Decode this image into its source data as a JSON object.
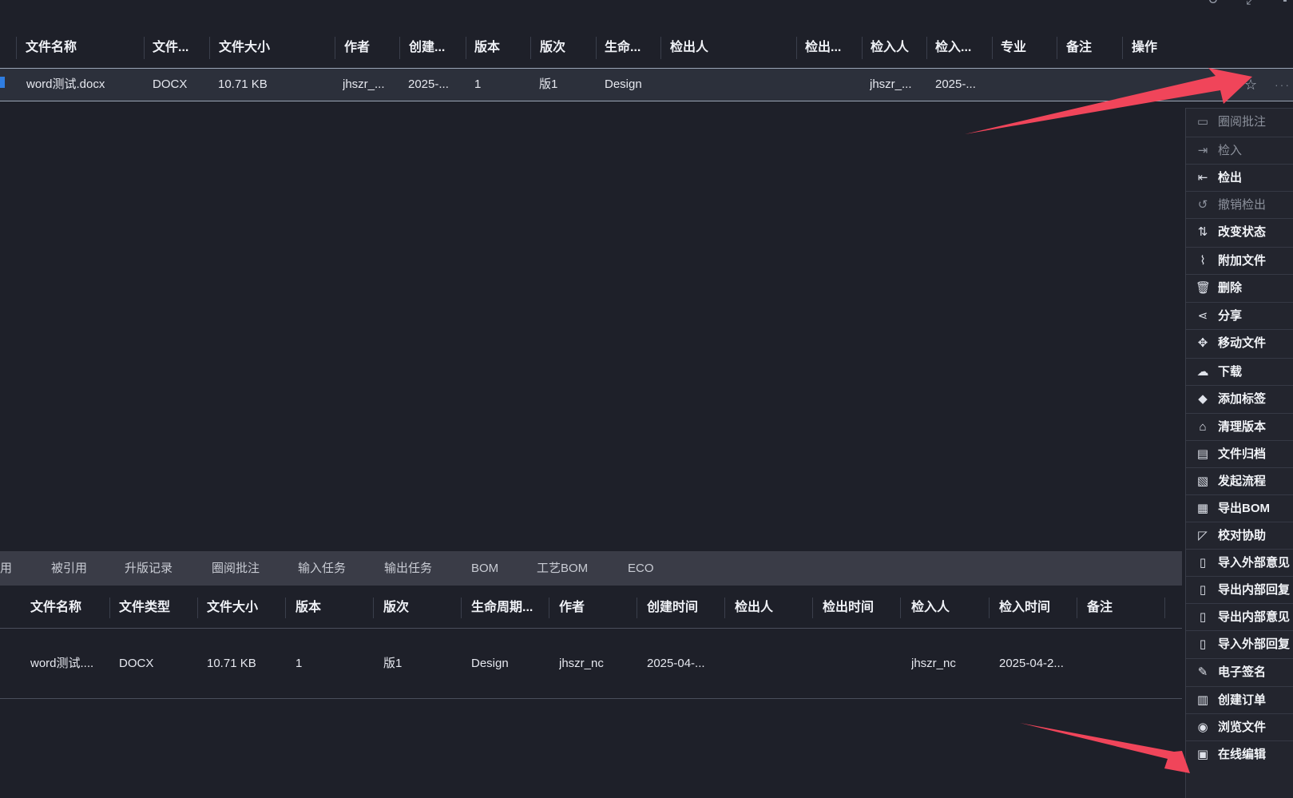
{
  "main_table": {
    "headers": [
      "文件名称",
      "文件...",
      "文件大小",
      "作者",
      "创建...",
      "版本",
      "版次",
      "生命...",
      "检出人",
      "检出...",
      "检入人",
      "检入...",
      "专业",
      "备注",
      "操作"
    ],
    "row": {
      "name": "word测试.docx",
      "type": "DOCX",
      "size": "10.71 KB",
      "author": "jhszr_...",
      "created": "2025-...",
      "version": "1",
      "revision": "版1",
      "lifecycle": "Design",
      "checkin_user": "jhszr_...",
      "checkin_time": "2025-..."
    }
  },
  "lower_panel": {
    "tabs": [
      "用",
      "被引用",
      "升版记录",
      "圈阅批注",
      "输入任务",
      "输出任务",
      "BOM",
      "工艺BOM",
      "ECO"
    ],
    "headers": [
      "文件名称",
      "文件类型",
      "文件大小",
      "版本",
      "版次",
      "生命周期...",
      "作者",
      "创建时间",
      "检出人",
      "检出时间",
      "检入人",
      "检入时间",
      "备注"
    ],
    "row": {
      "name": "word测试....",
      "type": "DOCX",
      "size": "10.71 KB",
      "version": "1",
      "revision": "版1",
      "lifecycle": "Design",
      "author": "jhszr_nc",
      "created": "2025-04-...",
      "checkin_user": "jhszr_nc",
      "checkin_time": "2025-04-2..."
    }
  },
  "context_menu": {
    "items": [
      {
        "label": "圈阅批注",
        "icon": "comment-icon",
        "disabled": true
      },
      {
        "label": "检入",
        "icon": "check-in-icon",
        "disabled": true
      },
      {
        "label": "检出",
        "icon": "check-out-icon",
        "disabled": false
      },
      {
        "label": "撤销检出",
        "icon": "undo-checkout-icon",
        "disabled": true
      },
      {
        "label": "改变状态",
        "icon": "swap-status-icon",
        "disabled": false
      },
      {
        "label": "附加文件",
        "icon": "paperclip-icon",
        "disabled": false
      },
      {
        "label": "删除",
        "icon": "trash-icon",
        "disabled": false
      },
      {
        "label": "分享",
        "icon": "share-icon",
        "disabled": false
      },
      {
        "label": "移动文件",
        "icon": "move-icon",
        "disabled": false
      },
      {
        "label": "下载",
        "icon": "cloud-download-icon",
        "disabled": false
      },
      {
        "label": "添加标签",
        "icon": "tag-icon",
        "disabled": false
      },
      {
        "label": "清理版本",
        "icon": "broom-icon",
        "disabled": false
      },
      {
        "label": "文件归档",
        "icon": "archive-icon",
        "disabled": false
      },
      {
        "label": "发起流程",
        "icon": "workflow-icon",
        "disabled": false
      },
      {
        "label": "导出BOM",
        "icon": "printer-icon",
        "disabled": false
      },
      {
        "label": "校对协助",
        "icon": "proofread-icon",
        "disabled": false
      },
      {
        "label": "导入外部意见",
        "icon": "import-doc-icon",
        "disabled": false
      },
      {
        "label": "导出内部回复",
        "icon": "export-doc-icon",
        "disabled": false
      },
      {
        "label": "导出内部意见",
        "icon": "export-doc-icon",
        "disabled": false
      },
      {
        "label": "导入外部回复",
        "icon": "import-doc-icon",
        "disabled": false
      },
      {
        "label": "电子签名",
        "icon": "signature-icon",
        "disabled": false
      },
      {
        "label": "创建订单",
        "icon": "order-icon",
        "disabled": false
      },
      {
        "label": "浏览文件",
        "icon": "eye-icon",
        "disabled": false
      },
      {
        "label": "在线编辑",
        "icon": "online-edit-icon",
        "disabled": false
      }
    ]
  },
  "colors": {
    "background": "#1e2029",
    "row_highlight": "#2c303b",
    "tab_bar": "#3a3c47",
    "annotation_arrow": "#f0455a",
    "file_icon": "#2f7de1"
  }
}
